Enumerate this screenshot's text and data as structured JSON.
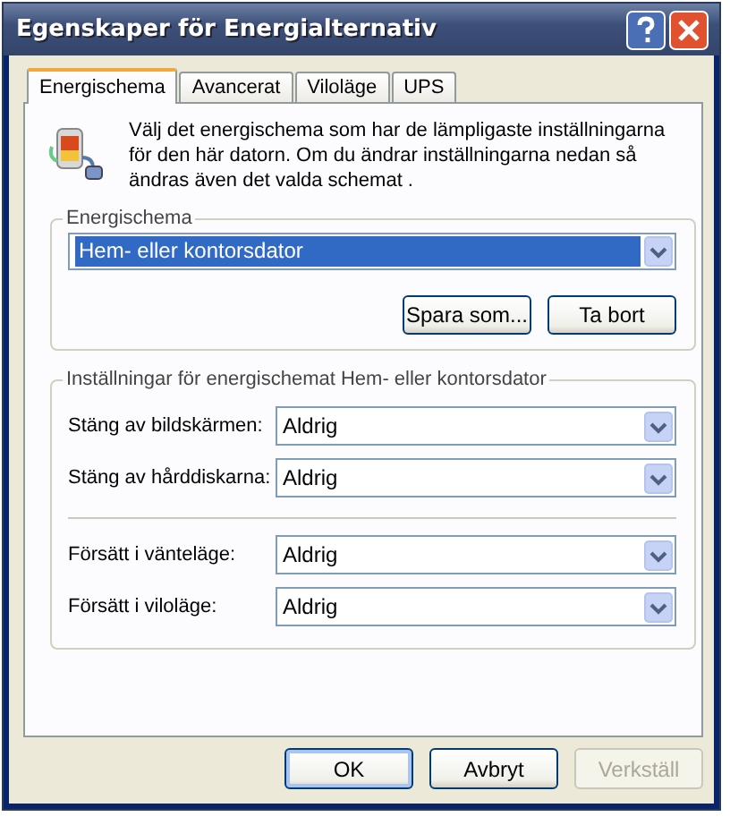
{
  "window": {
    "title": "Egenskaper för Energialternativ"
  },
  "tabs": [
    {
      "label": "Energischema",
      "selected": true
    },
    {
      "label": "Avancerat",
      "selected": false
    },
    {
      "label": "Viloläge",
      "selected": false
    },
    {
      "label": "UPS",
      "selected": false
    }
  ],
  "description": "Välj det energischema som har de lämpligaste inställningarna för den här datorn. Om du ändrar inställningarna nedan så ändras även det valda schemat .",
  "scheme_group": {
    "legend": "Energischema",
    "value": "Hem- eller kontorsdator",
    "buttons": [
      {
        "label": "Spara som..."
      },
      {
        "label": "Ta bort"
      }
    ]
  },
  "settings_group": {
    "legend": "Inställningar för energischemat Hem- eller kontorsdator",
    "sections": [
      [
        {
          "label": "Stäng av bildskärmen:",
          "value": "Aldrig"
        },
        {
          "label": "Stäng av hårddiskarna:",
          "value": "Aldrig"
        }
      ],
      [
        {
          "label": "Försätt i vänteläge:",
          "value": "Aldrig"
        },
        {
          "label": "Försätt i viloläge:",
          "value": "Aldrig"
        }
      ]
    ]
  },
  "buttons": [
    {
      "label": "OK",
      "default": true,
      "disabled": false
    },
    {
      "label": "Avbryt",
      "default": false,
      "disabled": false
    },
    {
      "label": "Verkställ",
      "default": false,
      "disabled": true
    }
  ]
}
